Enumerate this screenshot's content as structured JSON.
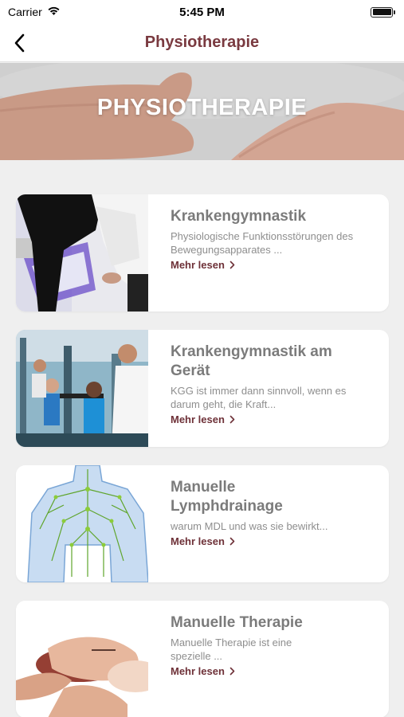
{
  "status_bar": {
    "carrier": "Carrier",
    "time": "5:45 PM"
  },
  "nav": {
    "title": "Physiotherapie"
  },
  "hero": {
    "title": "PHYSIOTHERAPIE"
  },
  "cards": [
    {
      "title": "Krankengymnastik",
      "description": "Physiologische Funktionsstörungen des Bewegungsapparates ...",
      "link": "Mehr lesen"
    },
    {
      "title": "Krankengymnastik am Gerät",
      "description": "KGG ist immer dann sinnvoll, wenn es darum geht, die Kraft...",
      "link": "Mehr lesen"
    },
    {
      "title": "Manuelle Lymphdrainage",
      "description": "warum MDL und was sie bewirkt...",
      "link": "Mehr lesen"
    },
    {
      "title": "Manuelle Therapie",
      "description": "Manuelle Therapie ist eine spezielle ...",
      "link": "Mehr lesen"
    }
  ],
  "colors": {
    "accent": "#7a3a40",
    "title_gray": "#7b7b7b",
    "background": "#efefef"
  }
}
